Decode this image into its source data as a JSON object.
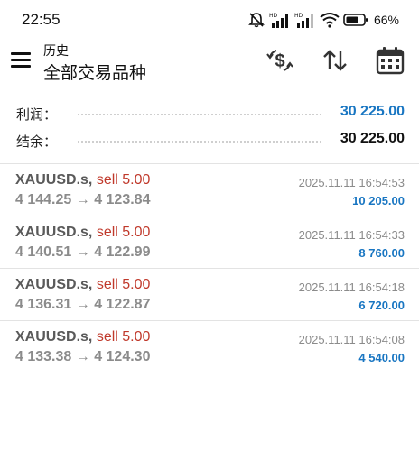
{
  "status_bar": {
    "time": "22:55",
    "battery_percent": "66%",
    "icons": [
      "mute-bell-icon",
      "hd-signal-icon",
      "hd-signal-icon",
      "wifi-icon",
      "battery-icon"
    ]
  },
  "header": {
    "subtitle": "历史",
    "title": "全部交易品种",
    "icons": [
      "menu-icon",
      "dollar-exchange-icon",
      "sort-arrows-icon",
      "calendar-icon"
    ]
  },
  "summary": {
    "profit_label": "利润：",
    "profit_value": "30 225.00",
    "balance_label": "结余：",
    "balance_value": "30 225.00"
  },
  "colors": {
    "profit_blue": "#1976c2",
    "sell_red": "#c0392b",
    "muted_gray": "#8b8b8b"
  },
  "trades": [
    {
      "symbol": "XAUUSD.s,",
      "side": "sell 5.00",
      "open_price": "4 144.25",
      "arrow": "→",
      "close_price": "4 123.84",
      "datetime": "2025.11.11 16:54:53",
      "profit": "10 205.00"
    },
    {
      "symbol": "XAUUSD.s,",
      "side": "sell 5.00",
      "open_price": "4 140.51",
      "arrow": "→",
      "close_price": "4 122.99",
      "datetime": "2025.11.11 16:54:33",
      "profit": "8 760.00"
    },
    {
      "symbol": "XAUUSD.s,",
      "side": "sell 5.00",
      "open_price": "4 136.31",
      "arrow": "→",
      "close_price": "4 122.87",
      "datetime": "2025.11.11 16:54:18",
      "profit": "6 720.00"
    },
    {
      "symbol": "XAUUSD.s,",
      "side": "sell 5.00",
      "open_price": "4 133.38",
      "arrow": "→",
      "close_price": "4 124.30",
      "datetime": "2025.11.11 16:54:08",
      "profit": "4 540.00"
    }
  ]
}
